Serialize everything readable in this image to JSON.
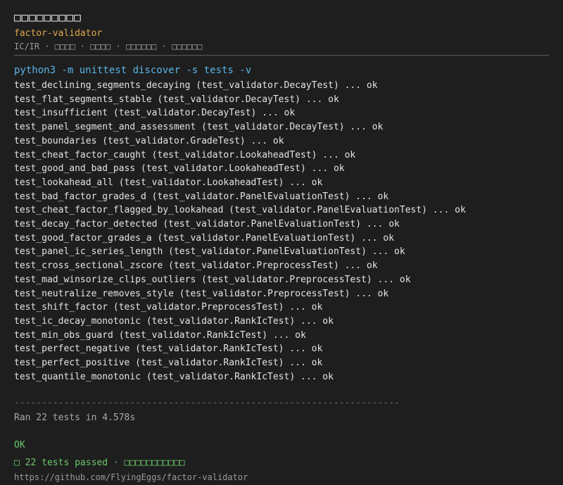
{
  "header": {
    "title": "□□□□□□□□□",
    "project": "factor-validator",
    "tags": "IC/IR · □□□□ · □□□□ · □□□□□□ · □□□□□□"
  },
  "command": "python3 -m unittest discover -s tests -v",
  "tests": [
    "test_declining_segments_decaying (test_validator.DecayTest) ... ok",
    "test_flat_segments_stable (test_validator.DecayTest) ... ok",
    "test_insufficient (test_validator.DecayTest) ... ok",
    "test_panel_segment_and_assessment (test_validator.DecayTest) ... ok",
    "test_boundaries (test_validator.GradeTest) ... ok",
    "test_cheat_factor_caught (test_validator.LookaheadTest) ... ok",
    "test_good_and_bad_pass (test_validator.LookaheadTest) ... ok",
    "test_lookahead_all (test_validator.LookaheadTest) ... ok",
    "test_bad_factor_grades_d (test_validator.PanelEvaluationTest) ... ok",
    "test_cheat_factor_flagged_by_lookahead (test_validator.PanelEvaluationTest) ... ok",
    "test_decay_factor_detected (test_validator.PanelEvaluationTest) ... ok",
    "test_good_factor_grades_a (test_validator.PanelEvaluationTest) ... ok",
    "test_panel_ic_series_length (test_validator.PanelEvaluationTest) ... ok",
    "test_cross_sectional_zscore (test_validator.PreprocessTest) ... ok",
    "test_mad_winsorize_clips_outliers (test_validator.PreprocessTest) ... ok",
    "test_neutralize_removes_style (test_validator.PreprocessTest) ... ok",
    "test_shift_factor (test_validator.PreprocessTest) ... ok",
    "test_ic_decay_monotonic (test_validator.RankIcTest) ... ok",
    "test_min_obs_guard (test_validator.RankIcTest) ... ok",
    "test_perfect_negative (test_validator.RankIcTest) ... ok",
    "test_perfect_positive (test_validator.RankIcTest) ... ok",
    "test_quantile_monotonic (test_validator.RankIcTest) ... ok"
  ],
  "separator": "----------------------------------------------------------------------",
  "summary": {
    "ran": "Ran 22 tests in 4.578s",
    "ok": "OK",
    "passed": "□ 22 tests passed · □□□□□□□□□□□",
    "url": "https://github.com/FlyingEggs/factor-validator"
  },
  "colors": {
    "background": "#1e1e1e",
    "project": "#e0a84c",
    "command": "#59b4e8",
    "success": "#6bc86b"
  }
}
